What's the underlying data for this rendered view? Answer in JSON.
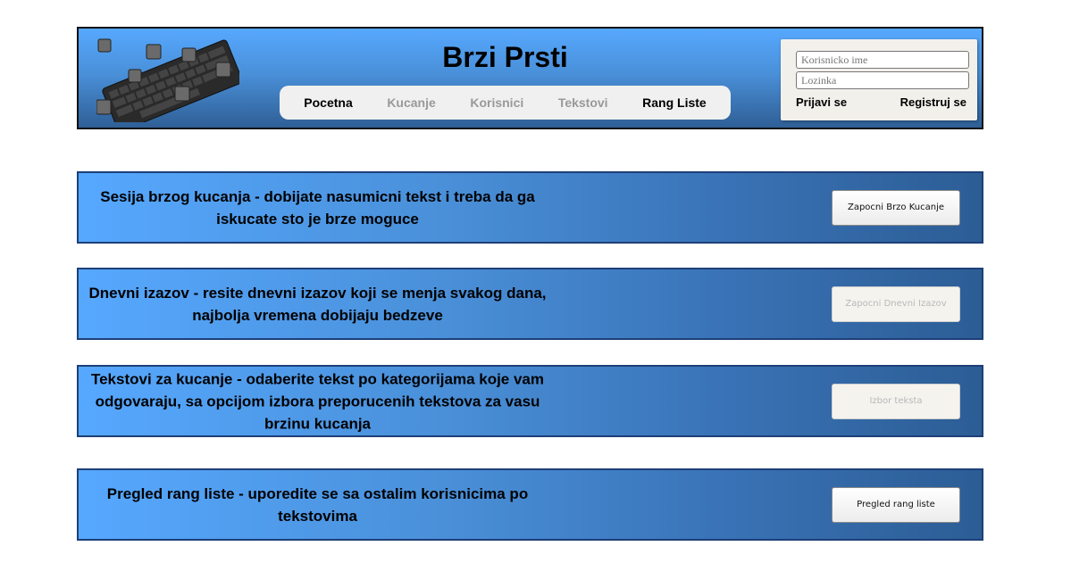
{
  "header": {
    "title": "Brzi Prsti",
    "nav": [
      {
        "label": "Pocetna",
        "enabled": true
      },
      {
        "label": "Kucanje",
        "enabled": false
      },
      {
        "label": "Korisnici",
        "enabled": false
      },
      {
        "label": "Tekstovi",
        "enabled": false
      },
      {
        "label": "Rang Liste",
        "enabled": true
      }
    ],
    "login": {
      "username_placeholder": "Korisnicko ime",
      "password_placeholder": "Lozinka",
      "login_label": "Prijavi se",
      "register_label": "Registruj se"
    }
  },
  "panels": [
    {
      "text": "Sesija brzog kucanja - dobijate nasumicni tekst i treba da ga iskucate sto je brze moguce",
      "button_label": "Zapocni Brzo Kucanje",
      "button_enabled": true
    },
    {
      "text": "Dnevni izazov - resite dnevni izazov koji se menja svakog dana, najbolja vremena dobijaju bedzeve",
      "button_label": "Zapocni Dnevni Izazov",
      "button_enabled": false
    },
    {
      "text": "Tekstovi za kucanje - odaberite tekst po kategorijama koje vam odgovaraju, sa opcijom izbora preporucenih tekstova za vasu brzinu kucanja",
      "button_label": "Izbor teksta",
      "button_enabled": false
    },
    {
      "text": "Pregled rang liste - uporedite se sa ostalim korisnicima po tekstovima",
      "button_label": "Pregled rang liste",
      "button_enabled": true
    }
  ],
  "colors": {
    "header_gradient_top": "#56a8ff",
    "header_gradient_bottom": "#2f5f96",
    "panel_gradient_left": "#56a8ff",
    "panel_gradient_right": "#2c5d95"
  }
}
